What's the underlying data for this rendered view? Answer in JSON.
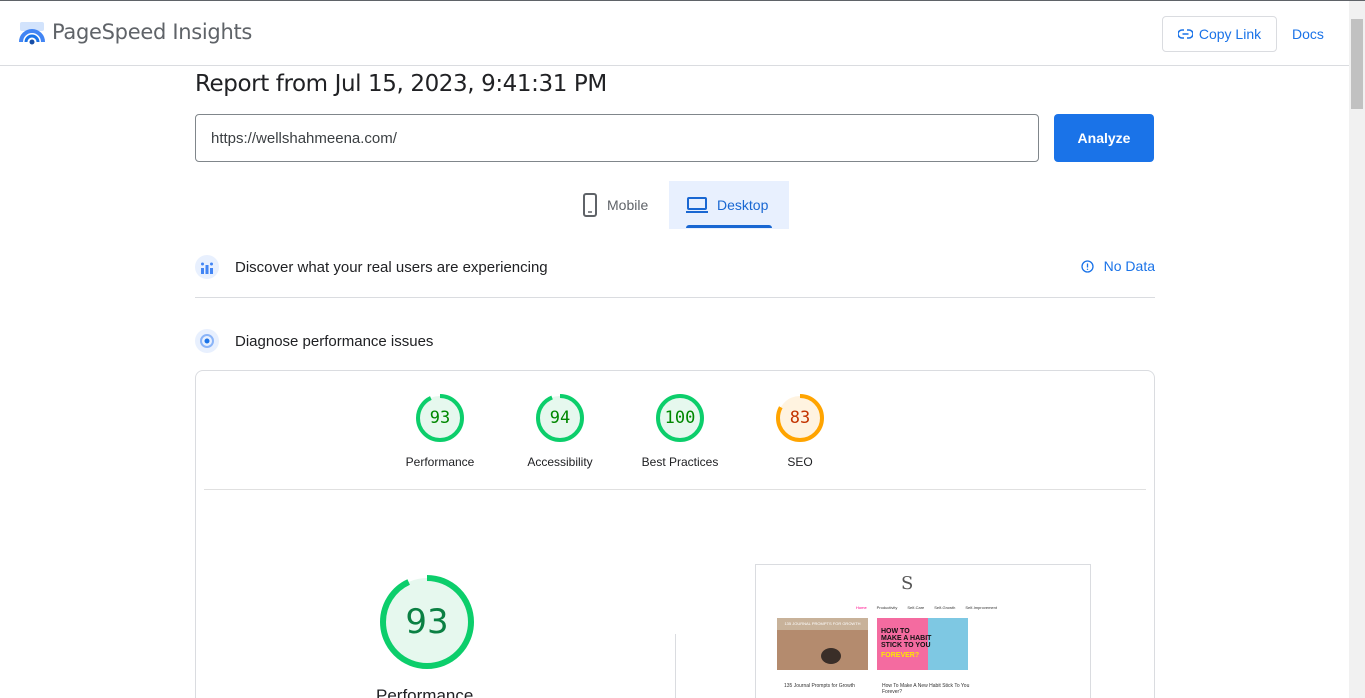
{
  "header": {
    "brand": "PageSpeed Insights",
    "copy_link_label": "Copy Link",
    "docs_label": "Docs"
  },
  "report": {
    "title": "Report from Jul 15, 2023, 9:41:31 PM",
    "url_value": "https://wellshahmeena.com/",
    "analyze_label": "Analyze"
  },
  "tabs": [
    {
      "label": "Mobile",
      "icon": "phone-icon",
      "selected": false
    },
    {
      "label": "Desktop",
      "icon": "laptop-icon",
      "selected": true
    }
  ],
  "sections": {
    "real_users": {
      "title": "Discover what your real users are experiencing",
      "status": "No Data"
    },
    "diagnose": {
      "title": "Diagnose performance issues"
    }
  },
  "scores": [
    {
      "label": "Performance",
      "value": "93",
      "fraction": 0.93,
      "status": "pass"
    },
    {
      "label": "Accessibility",
      "value": "94",
      "fraction": 0.94,
      "status": "pass"
    },
    {
      "label": "Best Practices",
      "value": "100",
      "fraction": 1.0,
      "status": "pass"
    },
    {
      "label": "SEO",
      "value": "83",
      "fraction": 0.83,
      "status": "average"
    }
  ],
  "main_score": {
    "label": "Performance",
    "value": "93",
    "fraction": 0.93
  },
  "thumbnail": {
    "nav": [
      "Home",
      "Productivity",
      "Self-Care",
      "Self-Growth",
      "Self-Improvement"
    ],
    "post1_header": "135 JOURNAL PROMPTS FOR GROWTH",
    "post1_caption": "135 Journal Prompts for Growth",
    "post2_title_lines": [
      "HOW TO",
      "MAKE A HABIT",
      "STICK TO YOU"
    ],
    "post2_highlight": "FOREVER?",
    "post2_caption": "How To Make A New Habit Stick To You Forever?"
  },
  "colors": {
    "accent": "#1a73e8",
    "pass": "#0cce6b",
    "pass_text": "#008800",
    "average": "#ffa400",
    "average_text": "#c33300"
  }
}
